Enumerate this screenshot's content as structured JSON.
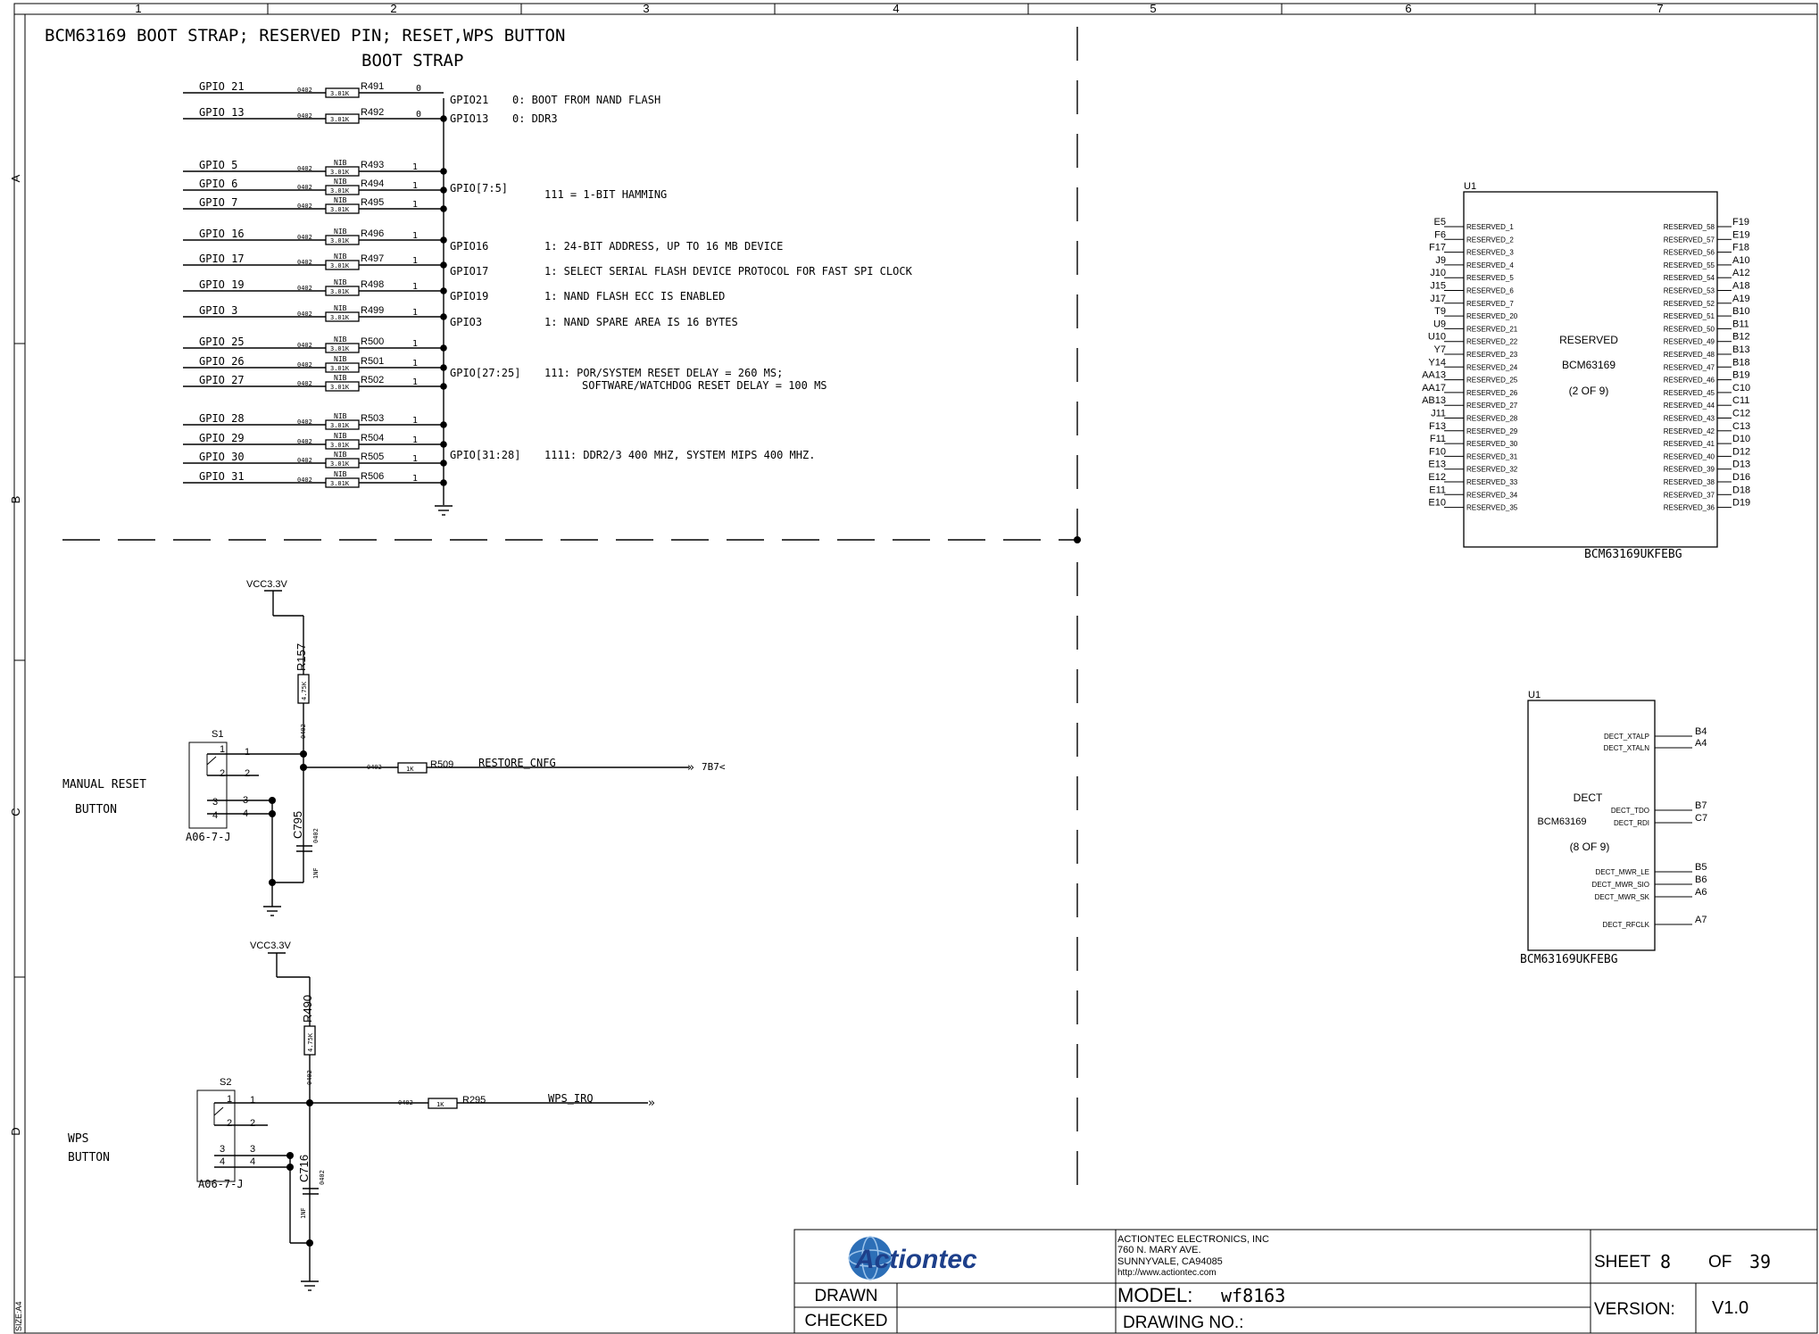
{
  "columns": [
    "1",
    "2",
    "3",
    "4",
    "5",
    "6",
    "7"
  ],
  "rows": [
    "A",
    "B",
    "C",
    "D"
  ],
  "size_label": "SIZE:A4",
  "title": "BCM63169 BOOT STRAP; RESERVED PIN; RESET,WPS BUTTON",
  "boot_strap_title": "BOOT STRAP",
  "boot_resistor_rows": [
    {
      "net": "GPIO_21",
      "fp": "0402",
      "val": "3.01K",
      "nib": "",
      "ref": "R491",
      "bit": "0"
    },
    {
      "net": "GPIO_13",
      "fp": "0402",
      "val": "3.01K",
      "nib": "",
      "ref": "R492",
      "bit": "0"
    },
    {
      "net": "GPIO_5",
      "fp": "0402",
      "val": "3.01K",
      "nib": "NIB",
      "ref": "R493",
      "bit": "1"
    },
    {
      "net": "GPIO_6",
      "fp": "0402",
      "val": "3.01K",
      "nib": "NIB",
      "ref": "R494",
      "bit": "1"
    },
    {
      "net": "GPIO_7",
      "fp": "0402",
      "val": "3.01K",
      "nib": "NIB",
      "ref": "R495",
      "bit": "1"
    },
    {
      "net": "GPIO_16",
      "fp": "0402",
      "val": "3.01K",
      "nib": "NIB",
      "ref": "R496",
      "bit": "1"
    },
    {
      "net": "GPIO_17",
      "fp": "0402",
      "val": "3.01K",
      "nib": "NIB",
      "ref": "R497",
      "bit": "1"
    },
    {
      "net": "GPIO_19",
      "fp": "0402",
      "val": "3.01K",
      "nib": "NIB",
      "ref": "R498",
      "bit": "1"
    },
    {
      "net": "GPIO_3",
      "fp": "0402",
      "val": "3.01K",
      "nib": "NIB",
      "ref": "R499",
      "bit": "1"
    },
    {
      "net": "GPIO_25",
      "fp": "0402",
      "val": "3.01K",
      "nib": "NIB",
      "ref": "R500",
      "bit": "1"
    },
    {
      "net": "GPIO_26",
      "fp": "0402",
      "val": "3.01K",
      "nib": "NIB",
      "ref": "R501",
      "bit": "1"
    },
    {
      "net": "GPIO_27",
      "fp": "0402",
      "val": "3.01K",
      "nib": "NIB",
      "ref": "R502",
      "bit": "1"
    },
    {
      "net": "GPIO_28",
      "fp": "0402",
      "val": "3.01K",
      "nib": "NIB",
      "ref": "R503",
      "bit": "1"
    },
    {
      "net": "GPIO_29",
      "fp": "0402",
      "val": "3.01K",
      "nib": "NIB",
      "ref": "R504",
      "bit": "1"
    },
    {
      "net": "GPIO_30",
      "fp": "0402",
      "val": "3.01K",
      "nib": "NIB",
      "ref": "R505",
      "bit": "1"
    },
    {
      "net": "GPIO_31",
      "fp": "0402",
      "val": "3.01K",
      "nib": "NIB",
      "ref": "R506",
      "bit": "1"
    }
  ],
  "boot_notes": [
    {
      "gpio": "GPIO21",
      "text": "0: BOOT FROM NAND FLASH"
    },
    {
      "gpio": "GPIO13",
      "text": "0: DDR3"
    },
    {
      "gpio": "GPIO[7:5]",
      "text": "111 = 1-BIT HAMMING"
    },
    {
      "gpio": "GPIO16",
      "text": "1: 24-BIT ADDRESS, UP TO 16 MB DEVICE"
    },
    {
      "gpio": "GPIO17",
      "text": "1: SELECT SERIAL FLASH DEVICE PROTOCOL FOR FAST SPI CLOCK"
    },
    {
      "gpio": "GPIO19",
      "text": "1: NAND FLASH ECC IS ENABLED"
    },
    {
      "gpio": "GPIO3",
      "text": "1: NAND SPARE AREA IS 16 BYTES"
    },
    {
      "gpio": "GPIO[27:25]",
      "text": "111: POR/SYSTEM RESET DELAY = 260 MS;"
    },
    {
      "gpio": "",
      "text": "SOFTWARE/WATCHDOG RESET DELAY = 100 MS"
    },
    {
      "gpio": "GPIO[31:28]",
      "text": "1111: DDR2/3 400 MHZ, SYSTEM MIPS 400 MHZ."
    }
  ],
  "u1_reserved": {
    "ref": "U1",
    "name1": "RESERVED",
    "name2": "BCM63169",
    "name3": "(2 OF 9)",
    "part": "BCM63169UKFEBG",
    "left_pins": [
      {
        "ball": "E5",
        "name": "RESERVED_1"
      },
      {
        "ball": "F6",
        "name": "RESERVED_2"
      },
      {
        "ball": "F17",
        "name": "RESERVED_3"
      },
      {
        "ball": "J9",
        "name": "RESERVED_4"
      },
      {
        "ball": "J10",
        "name": "RESERVED_5"
      },
      {
        "ball": "J15",
        "name": "RESERVED_6"
      },
      {
        "ball": "J17",
        "name": "RESERVED_7"
      },
      {
        "ball": "T9",
        "name": "RESERVED_20"
      },
      {
        "ball": "U9",
        "name": "RESERVED_21"
      },
      {
        "ball": "U10",
        "name": "RESERVED_22"
      },
      {
        "ball": "Y7",
        "name": "RESERVED_23"
      },
      {
        "ball": "Y14",
        "name": "RESERVED_24"
      },
      {
        "ball": "AA13",
        "name": "RESERVED_25"
      },
      {
        "ball": "AA17",
        "name": "RESERVED_26"
      },
      {
        "ball": "AB13",
        "name": "RESERVED_27"
      },
      {
        "ball": "J11",
        "name": "RESERVED_28"
      },
      {
        "ball": "F13",
        "name": "RESERVED_29"
      },
      {
        "ball": "F11",
        "name": "RESERVED_30"
      },
      {
        "ball": "F10",
        "name": "RESERVED_31"
      },
      {
        "ball": "E13",
        "name": "RESERVED_32"
      },
      {
        "ball": "E12",
        "name": "RESERVED_33"
      },
      {
        "ball": "E11",
        "name": "RESERVED_34"
      },
      {
        "ball": "E10",
        "name": "RESERVED_35"
      }
    ],
    "right_pins": [
      {
        "ball": "F19",
        "name": "RESERVED_58"
      },
      {
        "ball": "E19",
        "name": "RESERVED_57"
      },
      {
        "ball": "F18",
        "name": "RESERVED_56"
      },
      {
        "ball": "A10",
        "name": "RESERVED_55"
      },
      {
        "ball": "A12",
        "name": "RESERVED_54"
      },
      {
        "ball": "A18",
        "name": "RESERVED_53"
      },
      {
        "ball": "A19",
        "name": "RESERVED_52"
      },
      {
        "ball": "B10",
        "name": "RESERVED_51"
      },
      {
        "ball": "B11",
        "name": "RESERVED_50"
      },
      {
        "ball": "B12",
        "name": "RESERVED_49"
      },
      {
        "ball": "B13",
        "name": "RESERVED_48"
      },
      {
        "ball": "B18",
        "name": "RESERVED_47"
      },
      {
        "ball": "B19",
        "name": "RESERVED_46"
      },
      {
        "ball": "C10",
        "name": "RESERVED_45"
      },
      {
        "ball": "C11",
        "name": "RESERVED_44"
      },
      {
        "ball": "C12",
        "name": "RESERVED_43"
      },
      {
        "ball": "C13",
        "name": "RESERVED_42"
      },
      {
        "ball": "D10",
        "name": "RESERVED_41"
      },
      {
        "ball": "D12",
        "name": "RESERVED_40"
      },
      {
        "ball": "D13",
        "name": "RESERVED_39"
      },
      {
        "ball": "D16",
        "name": "RESERVED_38"
      },
      {
        "ball": "D18",
        "name": "RESERVED_37"
      },
      {
        "ball": "D19",
        "name": "RESERVED_36"
      }
    ]
  },
  "u1_dect": {
    "ref": "U1",
    "name1": "DECT",
    "name2": "BCM63169",
    "name3": "(8 OF 9)",
    "part": "BCM63169UKFEBG",
    "pins": [
      {
        "ball": "B4",
        "name": "DECT_XTALP"
      },
      {
        "ball": "A4",
        "name": "DECT_XTALN"
      },
      {
        "ball": "B7",
        "name": "DECT_TDO"
      },
      {
        "ball": "C7",
        "name": "DECT_RDI"
      },
      {
        "ball": "B5",
        "name": "DECT_MWR_LE"
      },
      {
        "ball": "B6",
        "name": "DECT_MWR_SIO"
      },
      {
        "ball": "A6",
        "name": "DECT_MWR_SK"
      },
      {
        "ball": "A7",
        "name": "DECT_RFCLK"
      }
    ]
  },
  "reset": {
    "label1": "MANUAL RESET",
    "label2": "BUTTON",
    "switch_ref": "S1",
    "switch_part": "A06-7-J",
    "pins": [
      "1",
      "2",
      "3",
      "4"
    ],
    "pin_1": "1",
    "pin_2": "2",
    "pin_3": "3",
    "pin_4": "4",
    "vcc": "VCC3.3V",
    "pullup_ref": "R157",
    "pullup_val": "4.75K",
    "pullup_fp": "0402",
    "series_ref": "R509",
    "series_val": "1K",
    "series_fp": "0402",
    "net": "RESTORE_CNFG",
    "offpage": "7B7<",
    "cap_ref": "C795",
    "cap_val": "1NF",
    "cap_fp": "0402"
  },
  "wps": {
    "label1": "WPS",
    "label2": "BUTTON",
    "switch_ref": "S2",
    "switch_part": "A06-7-J",
    "pin_1": "1",
    "pin_2": "2",
    "pin_3": "3",
    "pin_4": "4",
    "vcc": "VCC3.3V",
    "pullup_ref": "R490",
    "pullup_val": "4.75K",
    "pullup_fp": "0402",
    "series_ref": "R295",
    "series_val": "1K",
    "series_fp": "0402",
    "net": "WPS_IRQ",
    "cap_ref": "C716",
    "cap_val": "1NF",
    "cap_fp": "0402"
  },
  "title_block": {
    "logo": "Actiontec",
    "company": "ACTIONTEC ELECTRONICS, INC",
    "address1": "760 N. MARY AVE.",
    "address2": "SUNNYVALE, CA94085",
    "url": "http://www.actiontec.com",
    "drawn": "DRAWN",
    "checked": "CHECKED",
    "model_label": "MODEL:",
    "model": "wf8163",
    "drawing_no": "DRAWING NO.:",
    "sheet_label": "SHEET",
    "sheet": "8",
    "of_label": "OF",
    "of": "39",
    "version_label": "VERSION:",
    "version": "V1.0"
  }
}
